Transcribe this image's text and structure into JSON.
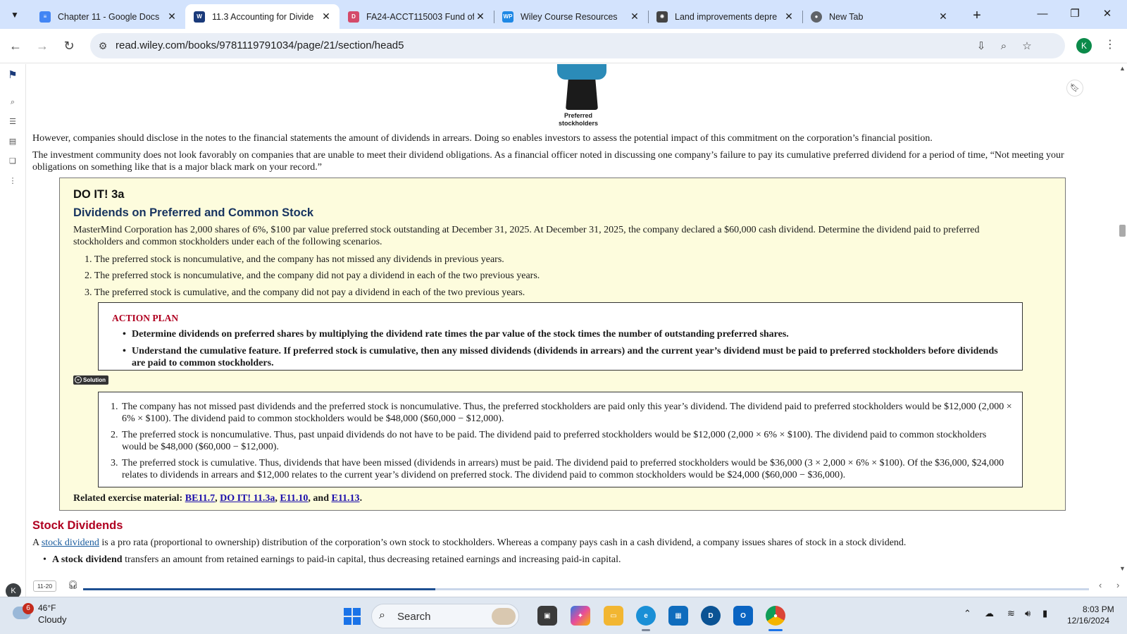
{
  "tabs": [
    {
      "title": "Chapter 11 - Google Docs",
      "icon": "google-docs-icon",
      "color": "#4285f4"
    },
    {
      "title": "11.3 Accounting for Divide",
      "icon": "wiley-reader-icon",
      "color": "#1a3a7a"
    },
    {
      "title": "FA24-ACCT115003 Fund of",
      "icon": "brightspace-icon",
      "color": "#d44a6a"
    },
    {
      "title": "Wiley Course Resources",
      "icon": "wileyplus-icon",
      "color": "#1e88e5"
    },
    {
      "title": "Land improvements depre",
      "icon": "openai-icon",
      "color": "#444444"
    },
    {
      "title": "New Tab",
      "icon": "chrome-icon",
      "color": "#5f6368"
    }
  ],
  "toolbar": {
    "url": "read.wiley.com/books/9781119791034/page/21/section/head5",
    "profile_initial": "K"
  },
  "figure": {
    "caption_line1": "Preferred",
    "caption_line2": "stockholders"
  },
  "content": {
    "p1": "However, companies should disclose in the notes to the financial statements the amount of dividends in arrears. Doing so enables investors to assess the potential impact of this commitment on the corporation’s financial position.",
    "p2": "The investment community does not look favorably on companies that are unable to meet their dividend obligations. As a financial officer noted in discussing one company’s failure to pay its cumulative preferred dividend for a period of time, “Not meeting your obligations on something like that is a major black mark on your record.”",
    "doit": {
      "label": "DO IT! 3a",
      "title": "Dividends on Preferred and Common Stock",
      "intro": "MasterMind Corporation has 2,000 shares of 6%, $100 par value preferred stock outstanding at December 31, 2025. At December 31, 2025, the company declared a $60,000 cash dividend. Determine the dividend paid to preferred stockholders and common stockholders under each of the following scenarios.",
      "scenarios": [
        "1. The preferred stock is noncumulative, and the company has not missed any dividends in previous years.",
        "2. The preferred stock is noncumulative, and the company did not pay a dividend in each of the two previous years.",
        "3. The preferred stock is cumulative, and the company did not pay a dividend in each of the two previous years."
      ],
      "action_plan": {
        "heading": "ACTION PLAN",
        "items": [
          "Determine dividends on preferred shares by multiplying the dividend rate times the par value of the stock times the number of outstanding preferred shares.",
          "Understand the cumulative feature. If preferred stock is cumulative, then any missed dividends (dividends in arrears) and the current year’s dividend must be paid to preferred stockholders before dividends are paid to common stockholders."
        ]
      },
      "solution_label": "Solution",
      "solution": [
        {
          "num": "1.",
          "text": "The company has not missed past dividends and the preferred stock is noncumulative. Thus, the preferred stockholders are paid only this year’s dividend. The dividend paid to preferred stockholders would be $12,000 (2,000 × 6% × $100). The dividend paid to common stockholders would be $48,000 ($60,000 − $12,000)."
        },
        {
          "num": "2.",
          "text": "The preferred stock is noncumulative. Thus, past unpaid dividends do not have to be paid. The dividend paid to preferred stockholders would be $12,000 (2,000 × 6% × $100). The dividend paid to common stockholders would be $48,000 ($60,000 − $12,000)."
        },
        {
          "num": "3.",
          "text": "The preferred stock is cumulative. Thus, dividends that have been missed (dividends in arrears) must be paid. The dividend paid to preferred stockholders would be $36,000 (3 × 2,000 × 6% × $100). Of the $36,000, $24,000 relates to dividends in arrears and $12,000 relates to the current year’s dividend on preferred stock. The dividend paid to common stockholders would be $24,000 ($60,000 − $36,000)."
        }
      ],
      "related_prefix": "Related exercise material: ",
      "related_links": [
        "BE11.7",
        "DO IT! 11.3a",
        "E11.10",
        "E11.13"
      ],
      "related_sep1": ", ",
      "related_sep2": ", ",
      "related_sep3": ", and ",
      "related_end": "."
    },
    "stock_dividends": {
      "heading": "Stock Dividends",
      "p_prefix": "A ",
      "p_link": "stock dividend",
      "p_rest": " is a pro rata (proportional to ownership) distribution of the corporation’s own stock to stockholders. Whereas a company pays cash in a cash dividend, a company issues shares of stock in a stock dividend.",
      "bullet_bold": "A stock dividend",
      "bullet_rest": " transfers an amount from retained earnings to paid-in capital, thus decreasing retained earnings and increasing paid-in capital."
    }
  },
  "pagebar": {
    "page": "11-20",
    "progress": 0.35
  },
  "rail": {
    "avatar": "K"
  },
  "taskbar": {
    "weather_temp": "46°F",
    "weather_desc": "Cloudy",
    "weather_badge": "6",
    "search_label": "Search",
    "time": "8:03 PM",
    "date": "12/16/2024"
  }
}
